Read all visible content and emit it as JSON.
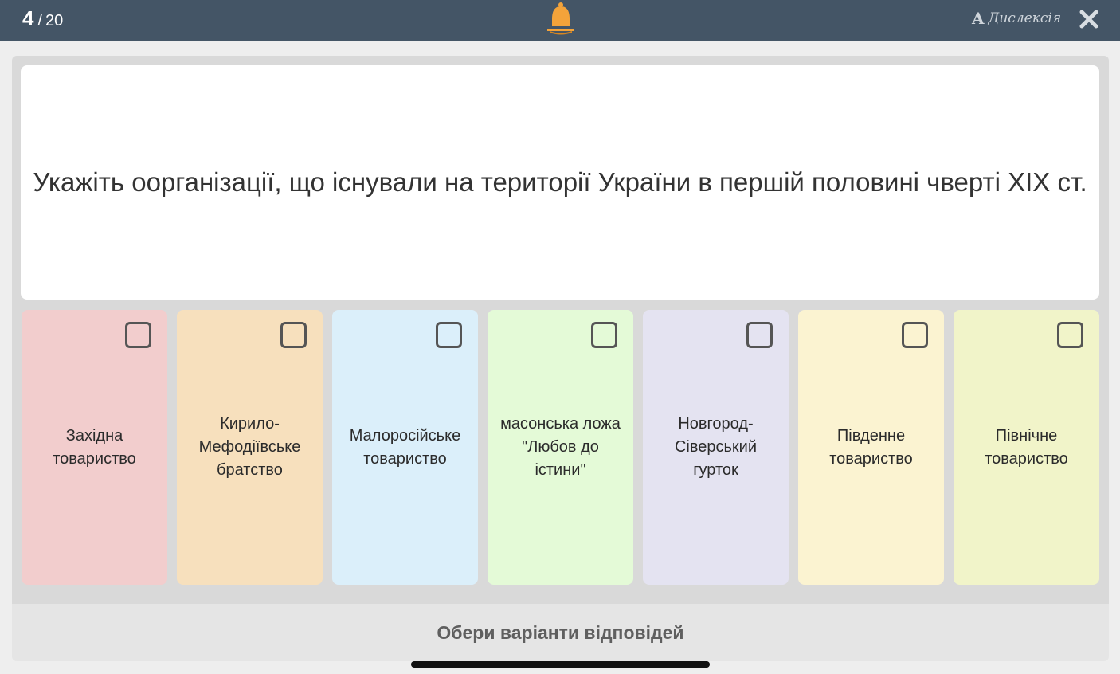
{
  "progress": {
    "current": "4",
    "separator": "/",
    "total": "20"
  },
  "header": {
    "notification_icon": "bell-icon",
    "dyslexia_letter": "A",
    "dyslexia_label": "Дислексія",
    "close_icon": "close-icon"
  },
  "question": {
    "text": "Укажіть оорганізації, що існували на території України в першій половині чверті XIX ст."
  },
  "options": [
    {
      "label": "Західна товариство",
      "color": "#f2cdcd",
      "checked": false
    },
    {
      "label": "Кирило-Мефодіївське братство",
      "color": "#f7e0bd",
      "checked": false
    },
    {
      "label": "Малоросійське товариство",
      "color": "#dbeffa",
      "checked": false
    },
    {
      "label": "масонська ложа \"Любов до істини\"",
      "color": "#e4fad7",
      "checked": false
    },
    {
      "label": "Новгород-Сіверський гурток",
      "color": "#e4e3f1",
      "checked": false
    },
    {
      "label": "Південне товариство",
      "color": "#fbf3d1",
      "checked": false
    },
    {
      "label": "Північне товариство",
      "color": "#f1f4c9",
      "checked": false
    }
  ],
  "footer": {
    "instruction": "Обери варіанти відповідей"
  },
  "colors": {
    "topbar": "#445566",
    "bell": "#f3a33a",
    "frame": "#d9d9d9"
  }
}
